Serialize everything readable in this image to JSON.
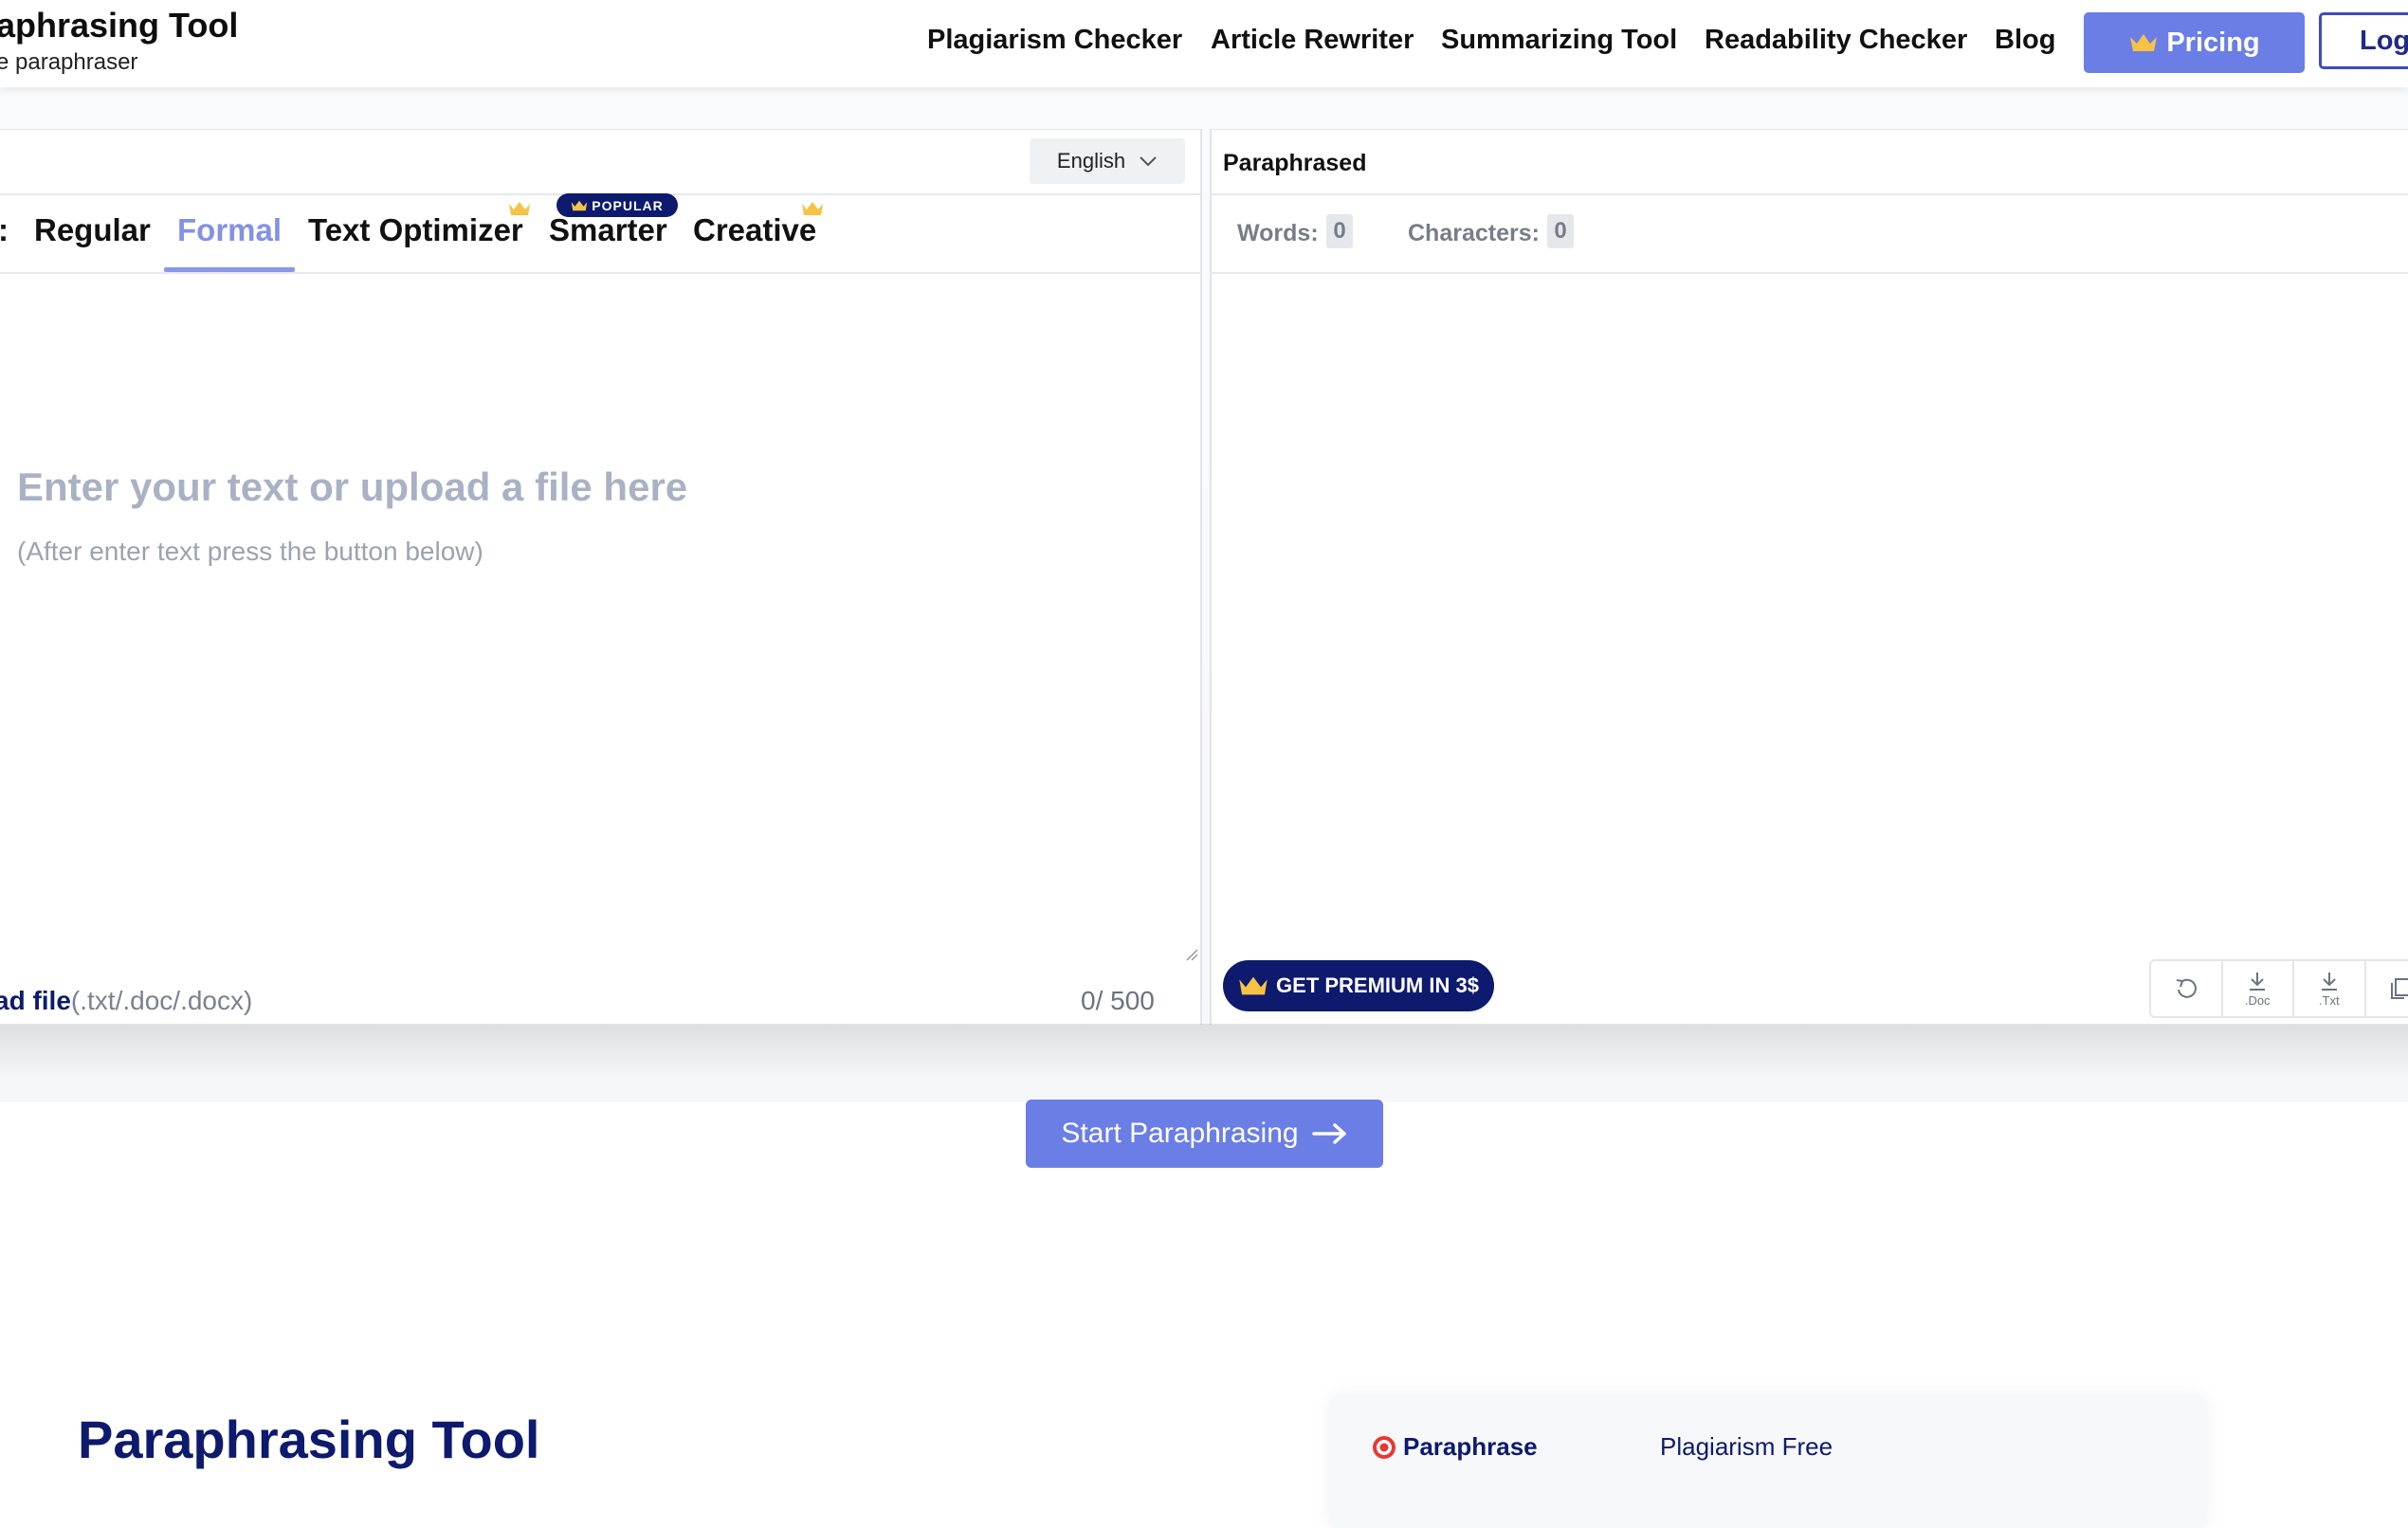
{
  "header": {
    "brand_title": "aphrasing Tool",
    "brand_subtitle": "e paraphraser",
    "nav": [
      "Plagiarism Checker",
      "Article Rewriter",
      "Summarizing Tool",
      "Readability Checker",
      "Blog"
    ],
    "pricing_label": "Pricing",
    "login_label": "Log",
    "accent_color": "#6a7ee6"
  },
  "input_panel": {
    "language": "English",
    "mode_prefix": ":",
    "modes": [
      "Regular",
      "Formal",
      "Text Optimizer",
      "Smarter",
      "Creative"
    ],
    "active_mode": "Formal",
    "popular_badge": "POPULAR",
    "placeholder_main": "Enter your text or upload a file here",
    "placeholder_sub": "(After enter text press the button below)",
    "upload_bold": "ad file",
    "upload_types": "(.txt/.doc/.docx)",
    "char_count": "0/ 500"
  },
  "output_panel": {
    "title": "Paraphrased",
    "words_label": "Words:",
    "words_value": "0",
    "characters_label": "Characters:",
    "characters_value": "0",
    "premium_label": "GET PREMIUM IN 3$",
    "tools": [
      {
        "icon": "undo-icon",
        "label": ""
      },
      {
        "icon": "download-doc-icon",
        "label": ".Doc"
      },
      {
        "icon": "download-txt-icon",
        "label": ".Txt"
      },
      {
        "icon": "copy-icon",
        "label": ""
      }
    ]
  },
  "action": {
    "start_label": "Start Paraphrasing"
  },
  "section": {
    "title": "Paraphrasing Tool",
    "features": [
      "Paraphrase",
      "Plagiarism Free"
    ]
  }
}
